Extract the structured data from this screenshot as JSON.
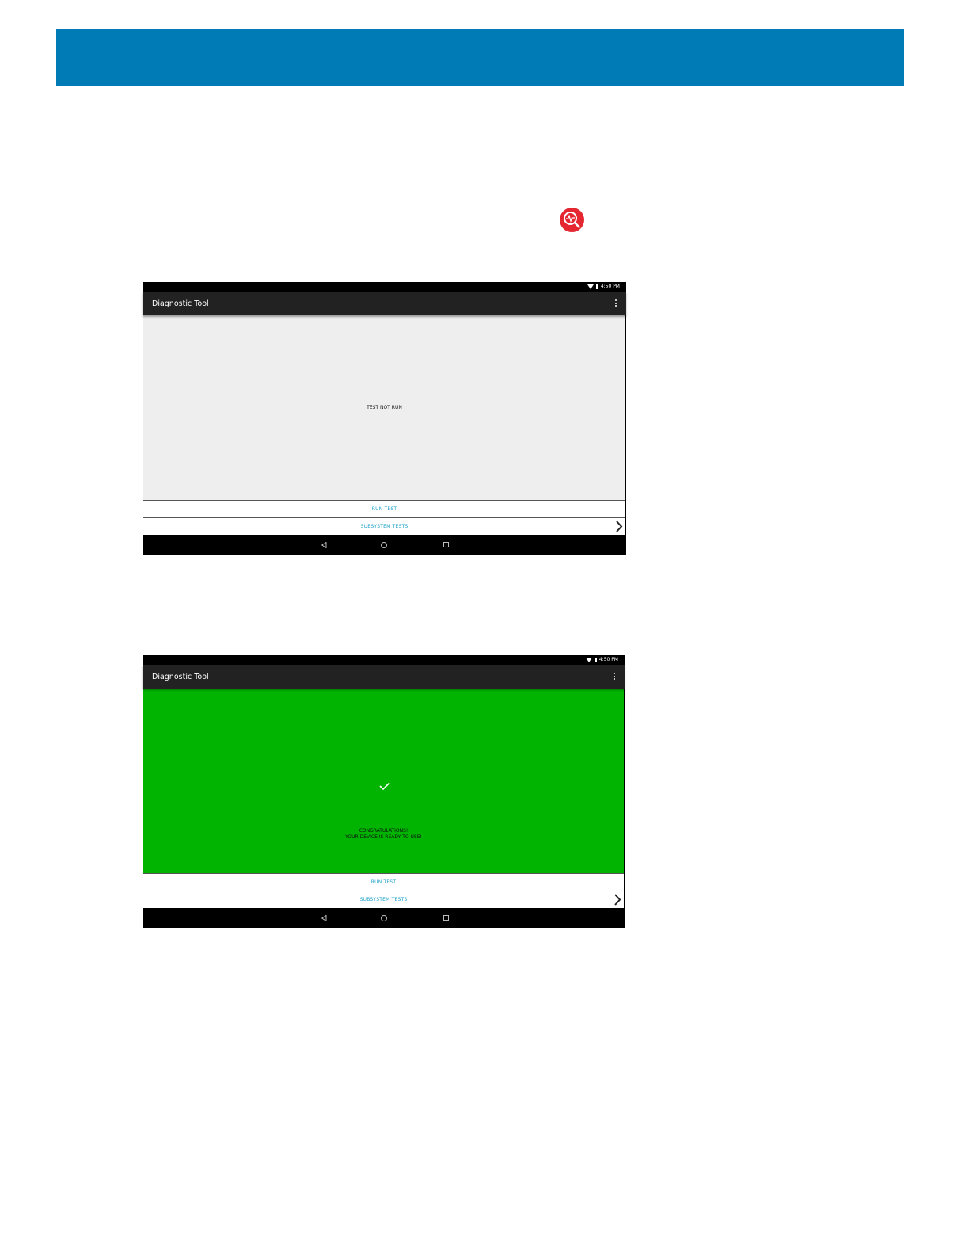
{
  "colors": {
    "header": "#007bb5",
    "icon": "#e42731",
    "pass": "#01b401",
    "button_text": "#1aa1c9"
  },
  "icons": {
    "app_icon": "diagnostic-magnifier-icon"
  },
  "screens": [
    {
      "status_time": "4:50 PM",
      "app_title": "Diagnostic Tool",
      "status_lines": [
        "TEST NOT RUN",
        ""
      ],
      "run_test": "RUN TEST",
      "subsystem_tests": "SUBSYSTEM TESTS"
    },
    {
      "status_time": "4:50 PM",
      "app_title": "Diagnostic Tool",
      "status_lines": [
        "CONGRATULATIONS!",
        "YOUR DEVICE IS READY TO USE!"
      ],
      "run_test": "RUN TEST",
      "subsystem_tests": "SUBSYSTEM TESTS"
    }
  ]
}
